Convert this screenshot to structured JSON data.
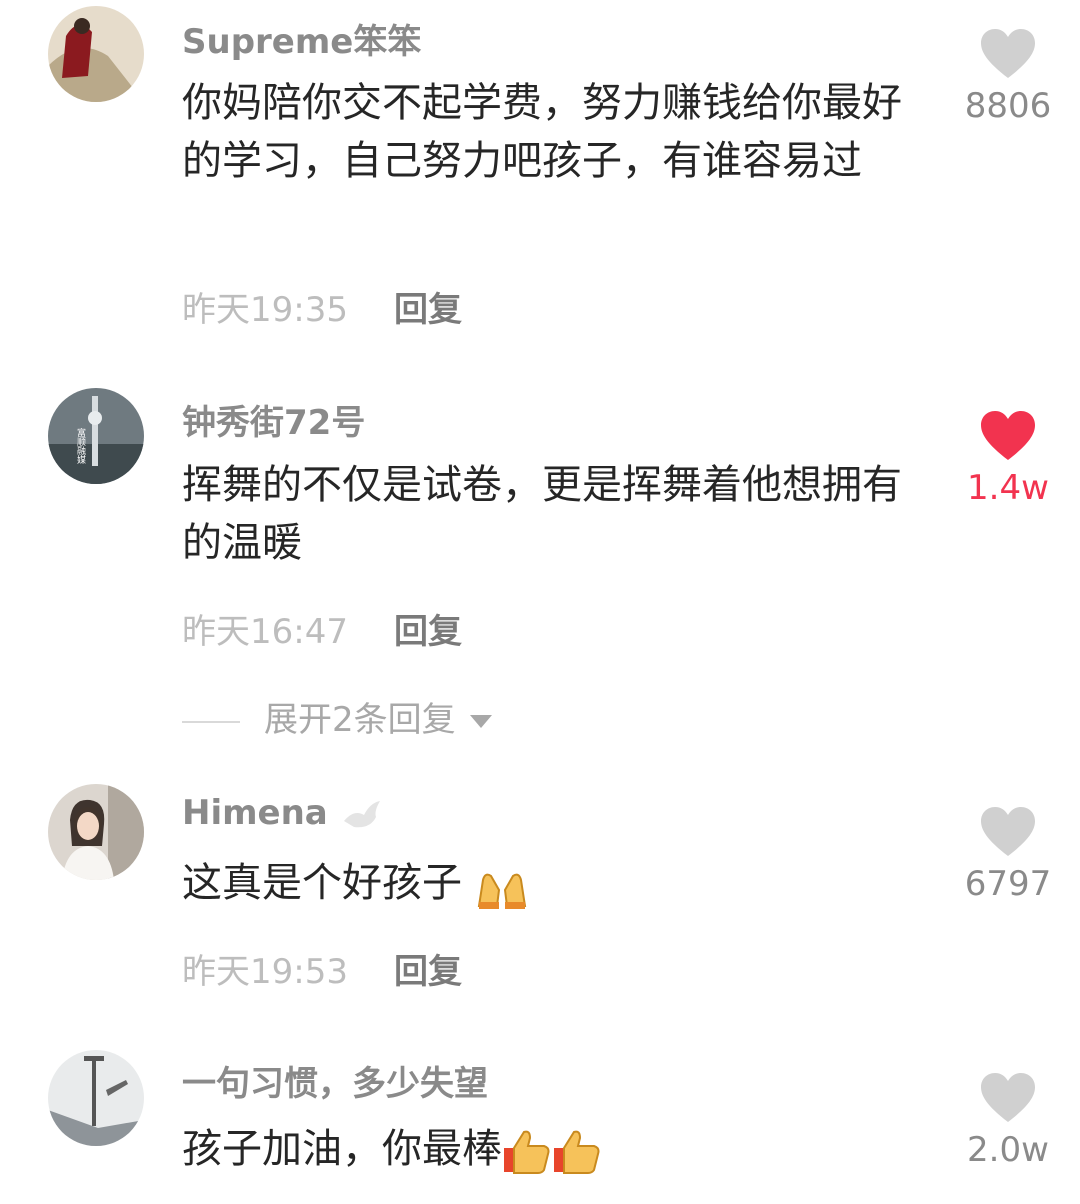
{
  "comments": [
    {
      "username": "Supreme笨笨",
      "text": "你妈陪你交不起学费，努力赚钱给你最好的学习，自己努力吧孩子，有谁容易过",
      "time": "昨天19:35",
      "reply_label": "回复",
      "likes": "8806",
      "liked": false
    },
    {
      "username": "钟秀街72号",
      "text": "挥舞的不仅是试卷，更是挥舞着他想拥有的温暖",
      "time": "昨天16:47",
      "reply_label": "回复",
      "likes": "1.4w",
      "liked": true,
      "expand_label": "展开2条回复",
      "avatar_text": "富顺融媒"
    },
    {
      "username": "Himena",
      "text": "这真是个好孩子",
      "emoji": "raising-hands-emoji",
      "time": "昨天19:53",
      "reply_label": "回复",
      "likes": "6797",
      "liked": false
    },
    {
      "username": "一句习惯，多少失望",
      "text": "孩子加油，你最棒",
      "emoji": "thumbs-up-emoji",
      "likes": "2.0w",
      "liked": false
    }
  ],
  "colors": {
    "like_gray": "#d0d0d0",
    "like_red": "#f2334f",
    "text": "#262626",
    "username": "#8a8a8a"
  }
}
